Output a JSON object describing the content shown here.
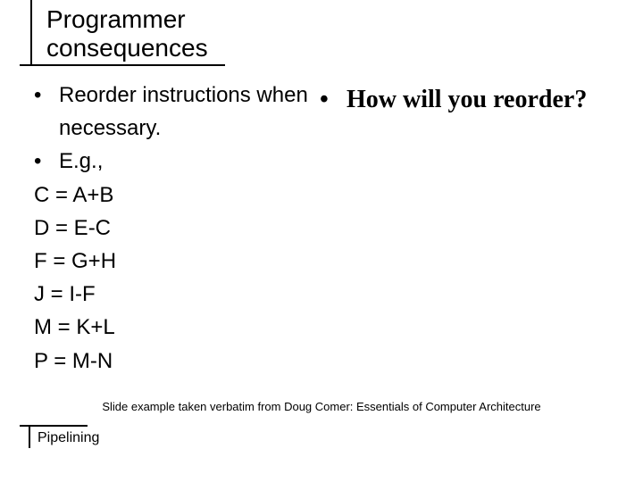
{
  "title": "Programmer consequences",
  "left": {
    "bullet1": "Reorder instructions when necessary.",
    "bullet2": "E.g.,",
    "eq1": "C = A+B",
    "eq2": "D = E-C",
    "eq3": "F = G+H",
    "eq4": "J = I-F",
    "eq5": "M = K+L",
    "eq6": "P = M-N"
  },
  "right": {
    "question": "How will you reorder?"
  },
  "attribution": "Slide example taken verbatim from Doug Comer: Essentials of Computer Architecture",
  "footer": "Pipelining"
}
